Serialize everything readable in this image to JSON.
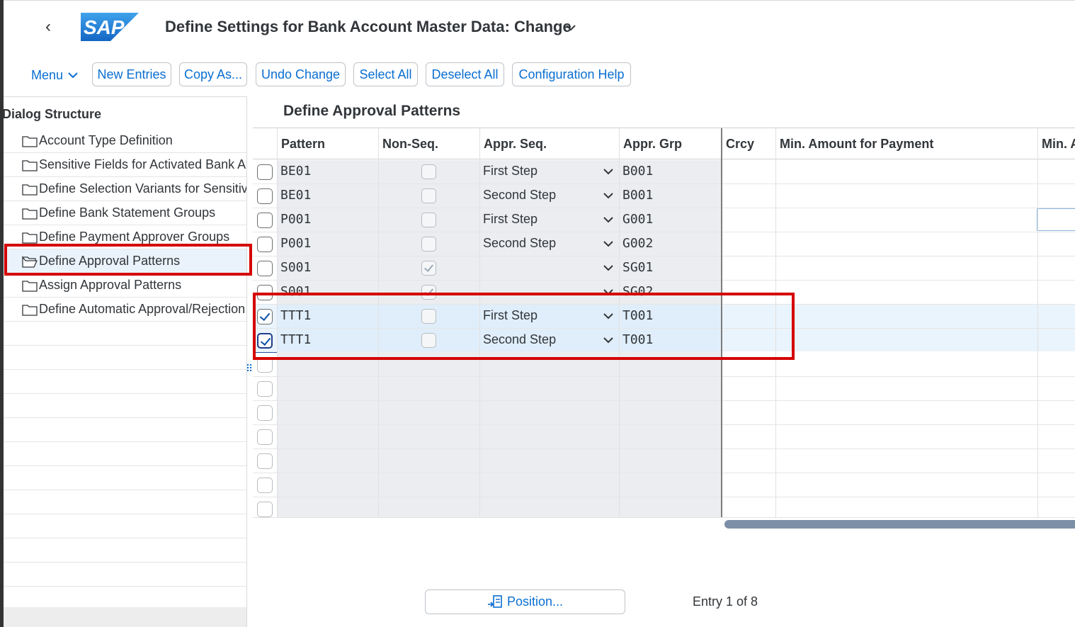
{
  "header": {
    "title": "Define Settings for Bank Account Master Data: Change",
    "logo_text": "SAP"
  },
  "toolbar": {
    "menu_label": "Menu",
    "buttons": [
      "New Entries",
      "Copy As...",
      "Undo Change",
      "Select All",
      "Deselect All",
      "Configuration Help"
    ]
  },
  "dialog_structure": {
    "title": "Dialog Structure",
    "items": [
      {
        "label": "Account Type Definition",
        "selected": false
      },
      {
        "label": "Sensitive Fields for Activated Bank Accounts",
        "selected": false
      },
      {
        "label": "Define Selection Variants for Sensitive Fields",
        "selected": false
      },
      {
        "label": "Define Bank Statement Groups",
        "selected": false
      },
      {
        "label": "Define Payment Approver Groups",
        "selected": false
      },
      {
        "label": "Define Approval Patterns",
        "selected": true
      },
      {
        "label": "Assign Approval Patterns",
        "selected": false
      },
      {
        "label": "Define Automatic Approval/Rejection",
        "selected": false
      }
    ]
  },
  "table": {
    "title": "Define Approval Patterns",
    "columns": [
      "Pattern",
      "Non-Seq.",
      "Appr. Seq.",
      "Appr. Grp",
      "Crcy",
      "Min. Amount for Payment",
      "Min. A"
    ],
    "rows": [
      {
        "pattern": "BE01",
        "non_seq": false,
        "appr_seq": "First Step",
        "appr_grp": "B001",
        "selected": false
      },
      {
        "pattern": "BE01",
        "non_seq": false,
        "appr_seq": "Second Step",
        "appr_grp": "B001",
        "selected": false
      },
      {
        "pattern": "P001",
        "non_seq": false,
        "appr_seq": "First Step",
        "appr_grp": "G001",
        "selected": false
      },
      {
        "pattern": "P001",
        "non_seq": false,
        "appr_seq": "Second Step",
        "appr_grp": "G002",
        "selected": false
      },
      {
        "pattern": "S001",
        "non_seq": true,
        "appr_seq": "",
        "appr_grp": "SG01",
        "selected": false
      },
      {
        "pattern": "S001",
        "non_seq": true,
        "appr_seq": "",
        "appr_grp": "SG02",
        "selected": false
      },
      {
        "pattern": "TTT1",
        "non_seq": false,
        "appr_seq": "First Step",
        "appr_grp": "T001",
        "selected": true
      },
      {
        "pattern": "TTT1",
        "non_seq": false,
        "appr_seq": "Second Step",
        "appr_grp": "T001",
        "selected": true
      }
    ],
    "empty_rows": 7
  },
  "footer": {
    "position_label": "Position...",
    "entry_text": "Entry 1 of 8"
  },
  "colors": {
    "accent": "#0a6ed1",
    "highlight": "#d40000",
    "sap_logo": "#1c6dd0"
  }
}
